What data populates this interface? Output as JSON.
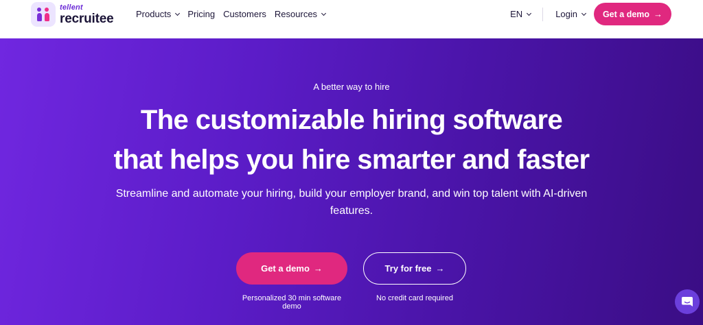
{
  "brand": {
    "name_top": "tellent",
    "name_main": "recruitee"
  },
  "nav": {
    "items": [
      {
        "label": "Products",
        "has_dropdown": true
      },
      {
        "label": "Pricing",
        "has_dropdown": false
      },
      {
        "label": "Customers",
        "has_dropdown": false
      },
      {
        "label": "Resources",
        "has_dropdown": true
      }
    ],
    "language": "EN",
    "login": "Login",
    "cta": "Get a demo"
  },
  "hero": {
    "eyebrow": "A better way to hire",
    "headline_line1": "The customizable hiring software",
    "headline_line2": "that helps you hire smarter and faster",
    "subhead": "Streamline and automate your hiring, build your employer brand, and win top talent with AI-driven features.",
    "primary_cta": "Get a demo",
    "primary_caption": "Personalized 30 min software demo",
    "secondary_cta": "Try for free",
    "secondary_caption": "No credit card required"
  },
  "icons": {
    "arrow": "arrow-right-icon",
    "chat": "chat-icon"
  },
  "colors": {
    "accent": "#e0287f",
    "hero_start": "#7027e0",
    "hero_end": "#3a0d84",
    "text_dark": "#1c1538"
  }
}
